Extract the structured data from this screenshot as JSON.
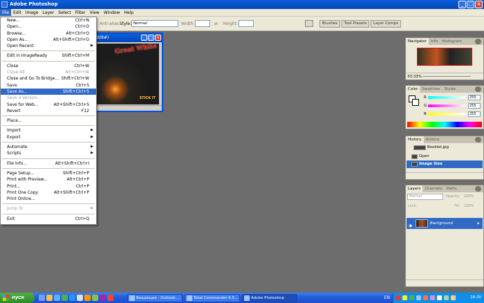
{
  "app": {
    "title": "Adobe Photoshop"
  },
  "menubar": [
    "File",
    "Edit",
    "Image",
    "Layer",
    "Select",
    "Filter",
    "View",
    "Window",
    "Help"
  ],
  "options": {
    "anti_alias": "Anti-alias",
    "style_label": "Style:",
    "style_value": "Normal",
    "width_label": "Width:",
    "height_label": "Height:"
  },
  "wells": [
    "Brushes",
    "Tool Presets",
    "Layer Comps"
  ],
  "document": {
    "title": "B/8#)",
    "art_title": "Great White",
    "art_caption": "STICK IT"
  },
  "file_menu": [
    {
      "label": "New...",
      "sc": "Ctrl+N"
    },
    {
      "label": "Open...",
      "sc": "Ctrl+O"
    },
    {
      "label": "Browse...",
      "sc": "Alt+Ctrl+O"
    },
    {
      "label": "Open As...",
      "sc": "Alt+Shift+Ctrl+O"
    },
    {
      "label": "Open Recent",
      "sub": true
    },
    {
      "sep": true
    },
    {
      "label": "Edit in ImageReady",
      "sc": "Shift+Ctrl+M"
    },
    {
      "sep": true
    },
    {
      "label": "Close",
      "sc": "Ctrl+W"
    },
    {
      "label": "Close All",
      "sc": "Alt+Ctrl+W",
      "dis": true
    },
    {
      "label": "Close and Go To Bridge...",
      "sc": "Shift+Ctrl+W"
    },
    {
      "label": "Save",
      "sc": "Ctrl+S"
    },
    {
      "label": "Save As...",
      "sc": "Shift+Ctrl+S",
      "hl": true
    },
    {
      "label": "Save a Version...",
      "dis": true
    },
    {
      "label": "Save for Web...",
      "sc": "Alt+Shift+Ctrl+S"
    },
    {
      "label": "Revert",
      "sc": "F12"
    },
    {
      "sep": true
    },
    {
      "label": "Place..."
    },
    {
      "sep": true
    },
    {
      "label": "Import",
      "sub": true
    },
    {
      "label": "Export",
      "sub": true
    },
    {
      "sep": true
    },
    {
      "label": "Automate",
      "sub": true
    },
    {
      "label": "Scripts",
      "sub": true
    },
    {
      "sep": true
    },
    {
      "label": "File Info...",
      "sc": "Alt+Shift+Ctrl+I"
    },
    {
      "sep": true
    },
    {
      "label": "Page Setup...",
      "sc": "Shift+Ctrl+P"
    },
    {
      "label": "Print with Preview...",
      "sc": "Alt+Ctrl+P"
    },
    {
      "label": "Print...",
      "sc": "Ctrl+P"
    },
    {
      "label": "Print One Copy",
      "sc": "Alt+Shift+Ctrl+P"
    },
    {
      "label": "Print Online..."
    },
    {
      "sep": true
    },
    {
      "label": "Jump To",
      "sub": true,
      "dis": true
    },
    {
      "sep": true
    },
    {
      "label": "Exit",
      "sc": "Ctrl+Q"
    }
  ],
  "navigator": {
    "tabs": [
      "Navigator",
      "Info",
      "Histogram"
    ],
    "zoom": "33.33%"
  },
  "color": {
    "tabs": [
      "Color",
      "Swatches",
      "Styles"
    ],
    "r": "255",
    "g": "255",
    "b": "255"
  },
  "history": {
    "tabs": [
      "History",
      "Actions"
    ],
    "items": [
      "Booklet.jpg",
      "Open",
      "Image Size"
    ]
  },
  "layers": {
    "tabs": [
      "Layers",
      "Channels",
      "Paths"
    ],
    "blend": "Normal",
    "opacity_label": "Opacity:",
    "opacity": "100%",
    "lock_label": "Lock:",
    "fill_label": "Fill:",
    "fill": "100%",
    "layer_name": "Background"
  },
  "taskbar": {
    "start": "пуск",
    "tasks": [
      "Входящие - Outlook ...",
      "Total Commander 6.5...",
      "Adobe Photoshop"
    ],
    "lang": "EN",
    "time": "18:30"
  },
  "colors": {
    "accent": "#316ac5",
    "title_blue": "#0245b9",
    "workspace": "#6d6d6d"
  }
}
